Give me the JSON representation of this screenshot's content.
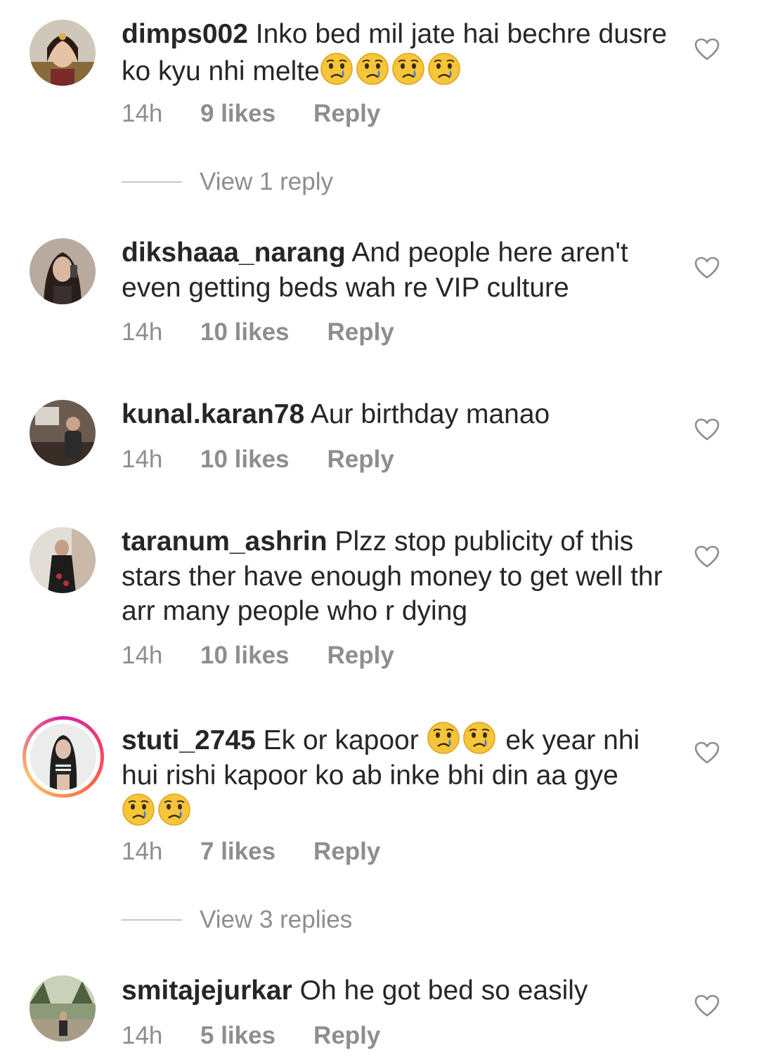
{
  "comments": [
    {
      "username": "dimps002",
      "text": "Inko bed mil jate hai bechre dusre ko kyu nhi melte",
      "trailing_emoji_count": 4,
      "emoji": "crying-face",
      "time": "14h",
      "likes": "9 likes",
      "reply_label": "Reply",
      "view_replies": "View 1 reply",
      "avatar_story_ring": false
    },
    {
      "username": "dikshaaa_narang",
      "text": "And people here aren't even getting beds wah re VIP culture",
      "time": "14h",
      "likes": "10 likes",
      "reply_label": "Reply",
      "avatar_story_ring": false
    },
    {
      "username": "kunal.karan78",
      "text": "Aur birthday manao",
      "time": "14h",
      "likes": "10 likes",
      "reply_label": "Reply",
      "avatar_story_ring": false
    },
    {
      "username": "taranum_ashrin",
      "text": "Plzz stop publicity of this stars ther have enough money to get well thr arr many people who r dying",
      "time": "14h",
      "likes": "10 likes",
      "reply_label": "Reply",
      "avatar_story_ring": false
    },
    {
      "username": "stuti_2745",
      "text_part1": "Ek or  kapoor",
      "inline_emoji_count": 2,
      "text_part2": "ek year nhi hui rishi kapoor ko ab inke bhi din aa gye",
      "trailing_emoji_count": 2,
      "emoji": "crying-face",
      "time": "14h",
      "likes": "7 likes",
      "reply_label": "Reply",
      "view_replies": "View 3 replies",
      "avatar_story_ring": true
    },
    {
      "username": "smitajejurkar",
      "text": "Oh he got bed so easily",
      "time": "14h",
      "likes": "5 likes",
      "reply_label": "Reply",
      "avatar_story_ring": false
    }
  ],
  "colors": {
    "text": "#262626",
    "meta": "#8e8e8e",
    "divider": "#c7c7c7",
    "emoji_face": "#f7c53a",
    "emoji_tear": "#3b7fd6"
  },
  "icons": {
    "like": "heart-outline-icon",
    "emoji": "crying-face-emoji"
  }
}
